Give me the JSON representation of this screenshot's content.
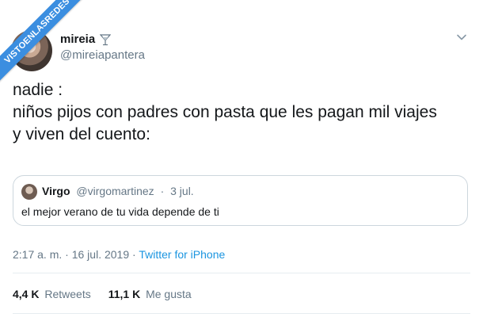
{
  "watermark": {
    "text": "VISTOENLASREDES"
  },
  "author": {
    "display_name": "mireia",
    "emoji_icon": "cocktail-glass-icon",
    "handle": "@mireiapantera"
  },
  "tweet": {
    "lines": [
      "nadie :",
      "niños pijos con padres con pasta que les pagan mil viajes",
      "y viven del cuento:"
    ]
  },
  "quote": {
    "name": "Virgo",
    "handle": "@virgomartinez",
    "separator": "·",
    "date": "3 jul.",
    "text": "el mejor verano de tu vida depende de ti"
  },
  "meta": {
    "time": "2:17 a. m.",
    "separator": "·",
    "date": "16 jul. 2019",
    "source": "Twitter for iPhone"
  },
  "stats": {
    "retweets_count": "4,4 K",
    "retweets_label": "Retweets",
    "likes_count": "11,1 K",
    "likes_label": "Me gusta"
  },
  "colors": {
    "link": "#1b95e0",
    "secondary_text": "#657786",
    "ribbon": "#3b8ee0"
  }
}
